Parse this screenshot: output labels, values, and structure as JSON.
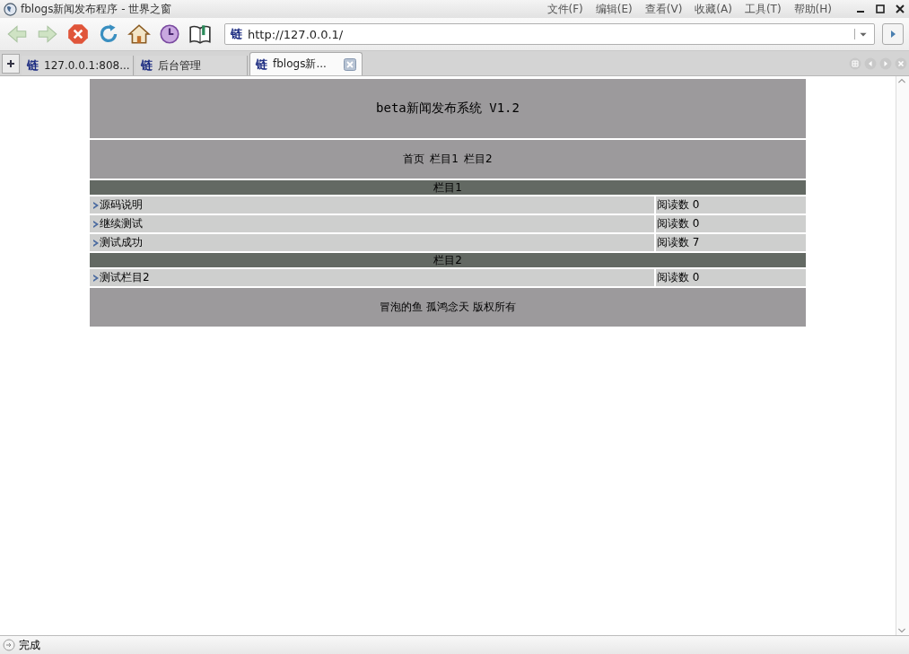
{
  "window": {
    "title": "fblogs新闻发布程序 - 世界之窗"
  },
  "menu": [
    "文件(F)",
    "编辑(E)",
    "查看(V)",
    "收藏(A)",
    "工具(T)",
    "帮助(H)"
  ],
  "toolbar": [
    {
      "kind": "back"
    },
    {
      "kind": "forward"
    },
    {
      "kind": "stop"
    },
    {
      "kind": "refresh"
    },
    {
      "kind": "home"
    },
    {
      "kind": "history"
    },
    {
      "kind": "favorites"
    }
  ],
  "address_bar": {
    "icon_text": "链",
    "value": "http://127.0.0.1/"
  },
  "tabs": [
    {
      "icon_text": "链",
      "label": "127.0.0.1:808...",
      "selected": false
    },
    {
      "icon_text": "链",
      "label": "后台管理",
      "selected": false
    },
    {
      "icon_text": "链",
      "label": "fblogs新...",
      "selected": true
    }
  ],
  "page": {
    "title": "beta新闻发布系统 V1.2",
    "nav": [
      "首页",
      "栏目1",
      "栏目2"
    ],
    "sections": [
      {
        "name": "栏目1",
        "articles": [
          {
            "title": "源码说明",
            "reads": "阅读数 0"
          },
          {
            "title": "继续测试",
            "reads": "阅读数 0"
          },
          {
            "title": "测试成功",
            "reads": "阅读数 7"
          }
        ]
      },
      {
        "name": "栏目2",
        "articles": [
          {
            "title": "测试栏目2",
            "reads": "阅读数 0"
          }
        ]
      }
    ],
    "footer": "冒泡的鱼 孤鸿念天 版权所有"
  },
  "status_bar": {
    "text": "完成"
  }
}
